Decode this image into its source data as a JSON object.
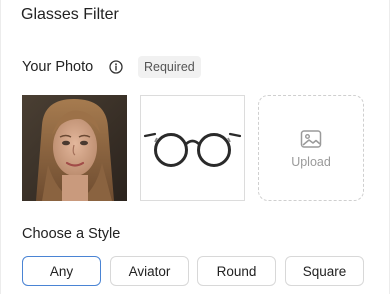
{
  "header": {
    "title": "Glasses Filter"
  },
  "photo_section": {
    "label": "Your Photo",
    "info_icon": "info-circle-icon",
    "badge": "Required"
  },
  "thumbnails": {
    "face_alt": "portrait photo",
    "glasses_alt": "round glasses",
    "upload_label": "Upload",
    "upload_icon": "image-icon"
  },
  "style_section": {
    "label": "Choose a Style",
    "options": [
      "Any",
      "Aviator",
      "Round",
      "Square"
    ],
    "selected": "Any"
  },
  "colors": {
    "accent": "#4a84d4",
    "border": "#d8d8d8",
    "badge_bg": "#f1f1f1"
  }
}
